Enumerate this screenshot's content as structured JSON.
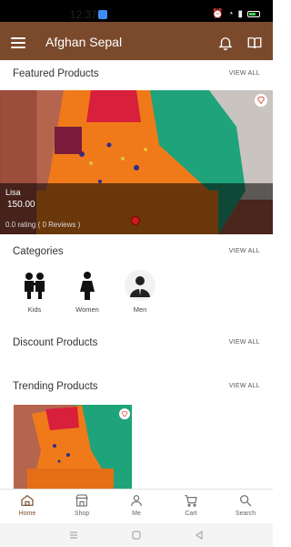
{
  "status_bar": {
    "time": "12:37",
    "icons": [
      "alarm-icon",
      "notification-icon",
      "wifi-icon",
      "signal-icon",
      "battery-icon"
    ]
  },
  "app_bar": {
    "title": "Afghan Sepal",
    "icons": [
      "menu-icon",
      "bell-icon",
      "book-icon"
    ]
  },
  "featured": {
    "title": "Featured Products",
    "view_all": "VIEW ALL",
    "product": {
      "name": "Lisa",
      "price": "150.00",
      "rating": "0.0 rating ( 0 Reviews )"
    }
  },
  "categories": {
    "title": "Categories",
    "view_all": "VIEW ALL",
    "items": [
      {
        "label": "Kids",
        "icon": "kids-icon"
      },
      {
        "label": "Women",
        "icon": "woman-icon"
      },
      {
        "label": "Men",
        "icon": "man-icon"
      }
    ]
  },
  "discount": {
    "title": "Discount Products",
    "view_all": "VIEW ALL"
  },
  "trending": {
    "title": "Trending Products",
    "view_all": "VIEW ALL"
  },
  "bottom_nav": {
    "items": [
      {
        "label": "Home",
        "icon": "home-icon",
        "active": true
      },
      {
        "label": "Shop",
        "icon": "shop-icon"
      },
      {
        "label": "Me",
        "icon": "person-icon"
      },
      {
        "label": "Cart",
        "icon": "cart-icon"
      },
      {
        "label": "Search",
        "icon": "search-icon"
      }
    ]
  },
  "colors": {
    "brand": "#7b4a2c",
    "accent_red": "#c91c1c"
  }
}
